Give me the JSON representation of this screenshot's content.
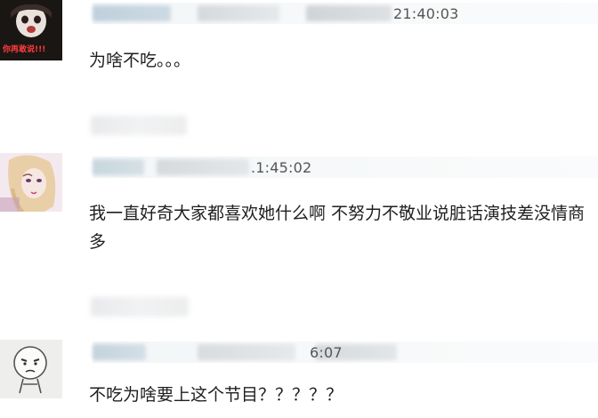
{
  "comments": [
    {
      "time": "21:40:03",
      "text": "为啥不吃。。。",
      "avatar_icon": "skull-meme-avatar-icon",
      "avatar_caption": "你再敢说!!!"
    },
    {
      "time": ".1:45:02",
      "text": "我一直好奇大家都喜欢她什么啊 不努力不敬业说脏话演技差没情商多",
      "avatar_icon": "anime-girl-avatar-icon"
    },
    {
      "time": "6:07",
      "text": "不吃为啥要上这个节目？？？？？",
      "avatar_icon": "cartoon-face-avatar-icon"
    }
  ]
}
